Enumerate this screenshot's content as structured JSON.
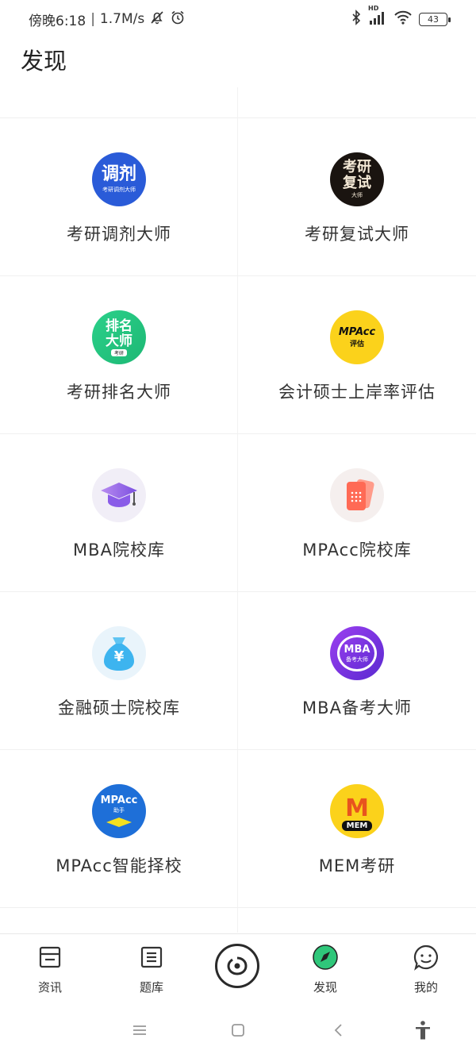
{
  "status_bar": {
    "time": "傍晚6:18",
    "speed": "1.7M/s",
    "battery": "43",
    "network": "HD"
  },
  "page": {
    "title": "发现"
  },
  "apps": [
    {
      "label": "考研调剂大师",
      "icon_text": "调剂",
      "icon_sub": "考研调剂大师",
      "color": "#2a5bd8"
    },
    {
      "label": "考研复试大师",
      "icon_text": "考研",
      "icon_text2": "复试",
      "icon_sub": "大师",
      "color": "#1a1410"
    },
    {
      "label": "考研排名大师",
      "icon_text": "排名",
      "icon_text2": "大师",
      "icon_sub": "考研",
      "color": "#2bc77e"
    },
    {
      "label": "会计硕士上岸率评估",
      "icon_text": "MPAcc",
      "icon_sub": "评估",
      "color": "#fbd21b"
    },
    {
      "label": "MBA院校库",
      "color": "#f1eef7"
    },
    {
      "label": "MPAcc院校库",
      "color": "#f5efee"
    },
    {
      "label": "金融硕士院校库",
      "icon_text": "¥",
      "color": "#e9f4fb"
    },
    {
      "label": "MBA备考大师",
      "icon_text": "MBA",
      "icon_sub": "备考大师",
      "color": "#7a2fd6"
    },
    {
      "label": "MPAcc智能择校",
      "icon_text": "MPAcc",
      "icon_sub": "助手",
      "color": "#1e6fd8"
    },
    {
      "label": "MEM考研",
      "icon_text": "M",
      "icon_sub": "MEM",
      "color": "#fbd21b"
    }
  ],
  "bottom_nav": [
    {
      "label": "资讯",
      "icon": "news-icon"
    },
    {
      "label": "题库",
      "icon": "question-bank-icon"
    },
    {
      "label": "",
      "icon": "center-camera-icon"
    },
    {
      "label": "发现",
      "icon": "discover-icon",
      "active": true
    },
    {
      "label": "我的",
      "icon": "profile-icon"
    }
  ],
  "system_nav": [
    "menu-icon",
    "home-icon",
    "back-icon",
    "accessibility-icon"
  ]
}
